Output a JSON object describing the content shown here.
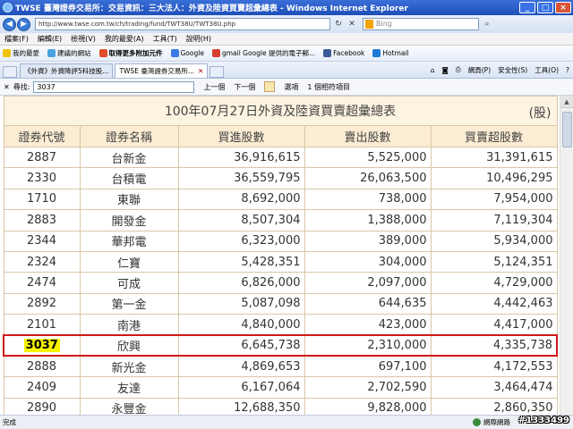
{
  "window": {
    "title": "TWSE 臺灣證券交易所：交易資訊：三大法人：外資及陸資買賣超彙總表 - Windows Internet Explorer"
  },
  "address": {
    "url": "http://www.twse.com.tw/ch/trading/fund/TWT38U/TWT38U.php",
    "search_placeholder": "Bing"
  },
  "menu": [
    "檔案(F)",
    "編輯(E)",
    "檢視(V)",
    "我的最愛(A)",
    "工具(T)",
    "說明(H)"
  ],
  "favorites": [
    {
      "label": "我的最愛"
    },
    {
      "label": "建議的網站"
    },
    {
      "label": "取得更多附加元件"
    },
    {
      "label": "Google"
    },
    {
      "label": "gmail Google 提供的電子郵..."
    },
    {
      "label": "Facebook"
    },
    {
      "label": "Hotmail"
    }
  ],
  "tabs": [
    {
      "label": "《外資》外資降評5科技股..."
    },
    {
      "label": "TWSE 臺灣證券交易所..."
    }
  ],
  "command_bar": [
    "網頁(P)",
    "安全性(S)",
    "工具(O)"
  ],
  "find": {
    "label": "尋找:",
    "value": "3037",
    "prev": "上一個",
    "next": "下一個",
    "options": "選項",
    "result": "1 個相符項目"
  },
  "report": {
    "title": "100年07月27日外資及陸資買賣超彙總表",
    "unit": "(股)",
    "headers": [
      "證券代號",
      "證券名稱",
      "買進股數",
      "賣出股數",
      "買賣超股數"
    ],
    "rows": [
      [
        "2887",
        "台新金",
        "36,916,615",
        "5,525,000",
        "31,391,615"
      ],
      [
        "2330",
        "台積電",
        "36,559,795",
        "26,063,500",
        "10,496,295"
      ],
      [
        "1710",
        "東聯",
        "8,692,000",
        "738,000",
        "7,954,000"
      ],
      [
        "2883",
        "開發金",
        "8,507,304",
        "1,388,000",
        "7,119,304"
      ],
      [
        "2344",
        "華邦電",
        "6,323,000",
        "389,000",
        "5,934,000"
      ],
      [
        "2324",
        "仁寶",
        "5,428,351",
        "304,000",
        "5,124,351"
      ],
      [
        "2474",
        "可成",
        "6,826,000",
        "2,097,000",
        "4,729,000"
      ],
      [
        "2892",
        "第一金",
        "5,087,098",
        "644,635",
        "4,442,463"
      ],
      [
        "2101",
        "南港",
        "4,840,000",
        "423,000",
        "4,417,000"
      ],
      [
        "3037",
        "欣興",
        "6,645,738",
        "2,310,000",
        "4,335,738"
      ],
      [
        "2888",
        "新光金",
        "4,869,653",
        "697,100",
        "4,172,553"
      ],
      [
        "2409",
        "友達",
        "6,167,064",
        "2,702,590",
        "3,464,474"
      ],
      [
        "2890",
        "永豐金",
        "12,688,350",
        "9,828,000",
        "2,860,350"
      ]
    ]
  },
  "status": {
    "text": "完成",
    "zone": "網際網路",
    "watermark": "#1333499"
  }
}
